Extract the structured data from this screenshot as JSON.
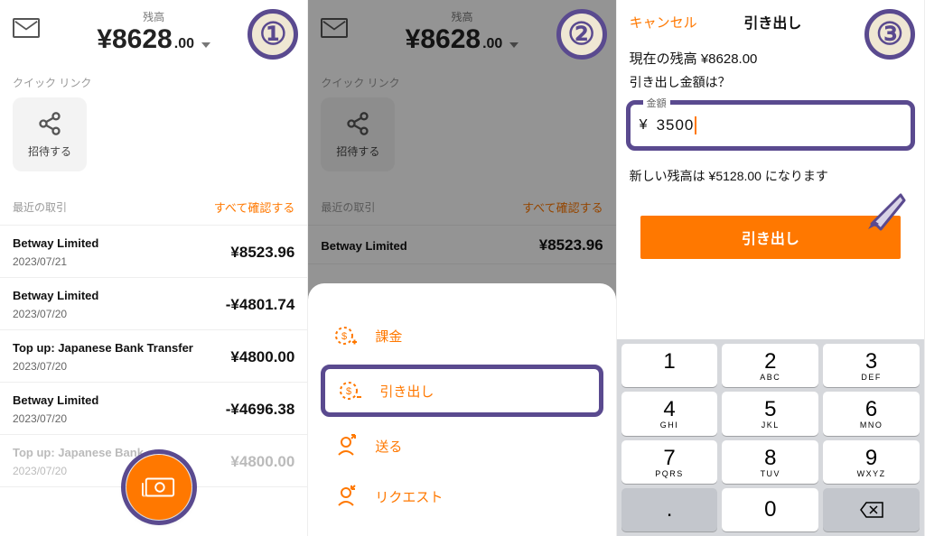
{
  "panel1": {
    "balance_label": "残高",
    "balance_int": "¥8628",
    "balance_dec": ".00",
    "quick_link_label": "クイック リンク",
    "invite_label": "招待する",
    "recent_label": "最近の取引",
    "see_all_label": "すべて確認する",
    "transactions": [
      {
        "name": "Betway Limited",
        "date": "2023/07/21",
        "amount": "¥8523.96"
      },
      {
        "name": "Betway Limited",
        "date": "2023/07/20",
        "amount": "-¥4801.74"
      },
      {
        "name": "Top up: Japanese Bank Transfer",
        "date": "2023/07/20",
        "amount": "¥4800.00"
      },
      {
        "name": "Betway Limited",
        "date": "2023/07/20",
        "amount": "-¥4696.38"
      },
      {
        "name": "Top up: Japanese Bank",
        "date": "2023/07/20",
        "amount": "¥4800.00"
      }
    ]
  },
  "panel2": {
    "balance_label": "残高",
    "balance_int": "¥8628",
    "balance_dec": ".00",
    "quick_link_label": "クイック リンク",
    "invite_label": "招待する",
    "recent_label": "最近の取引",
    "see_all_label": "すべて確認する",
    "tx0_name": "Betway Limited",
    "tx0_amount": "¥8523.96",
    "sheet": {
      "charge": "課金",
      "withdraw": "引き出し",
      "send": "送る",
      "request": "リクエスト"
    }
  },
  "panel3": {
    "cancel": "キャンセル",
    "title": "引き出し",
    "current_balance": "現在の残高 ¥8628.00",
    "prompt": "引き出し金額は？",
    "amount_label": "金額",
    "currency_symbol": "¥",
    "amount_value": "3500",
    "new_balance": "新しい残高は ¥5128.00 になります",
    "withdraw_button": "引き出し",
    "keys": {
      "k1": "1",
      "k2": "2",
      "k3": "3",
      "k4": "4",
      "k5": "5",
      "k6": "6",
      "k7": "7",
      "k8": "8",
      "k9": "9",
      "k0": "0",
      "kdot": ".",
      "s2": "ABC",
      "s3": "DEF",
      "s4": "GHI",
      "s5": "JKL",
      "s6": "MNO",
      "s7": "PQRS",
      "s8": "TUV",
      "s9": "WXYZ"
    }
  },
  "badges": {
    "b1": "①",
    "b2": "②",
    "b3": "③"
  }
}
